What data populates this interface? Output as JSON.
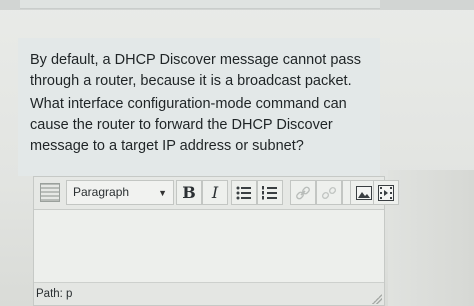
{
  "question": {
    "paragraph1": "By default, a DHCP Discover message cannot pass through a router, because it is a broadcast packet.",
    "paragraph2": "What interface configuration-mode command can cause the router to forward the DHCP Discover message to a target IP address or subnet?"
  },
  "editor": {
    "format_select_value": "Paragraph",
    "toolbar_icons": [
      "toolbar-toggle-icon",
      "bold-icon",
      "italic-icon",
      "bullet-list-icon",
      "numbered-list-icon",
      "link-icon",
      "unlink-icon",
      "image-icon",
      "media-icon"
    ],
    "bold_label": "B",
    "italic_label": "I",
    "path_label": "Path: p"
  }
}
